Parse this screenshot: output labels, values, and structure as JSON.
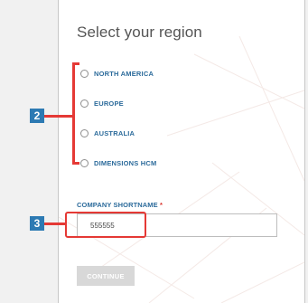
{
  "dialog": {
    "title": "Select your region",
    "regions": [
      {
        "label": "NORTH AMERICA",
        "selected": false
      },
      {
        "label": "EUROPE",
        "selected": false
      },
      {
        "label": "AUSTRALIA",
        "selected": false
      },
      {
        "label": "DIMENSIONS HCM",
        "selected": false
      }
    ],
    "company_field": {
      "label": "COMPANY SHORTNAME",
      "required_mark": "*",
      "value": "555555"
    },
    "continue_label": "CONTINUE"
  },
  "callouts": {
    "region_marker": "2",
    "company_marker": "3"
  },
  "colors": {
    "accent": "#2c6b9b",
    "annotation_red": "#e53935",
    "callout_blue": "#2d7ab3",
    "disabled_button": "#d8d8d8"
  }
}
